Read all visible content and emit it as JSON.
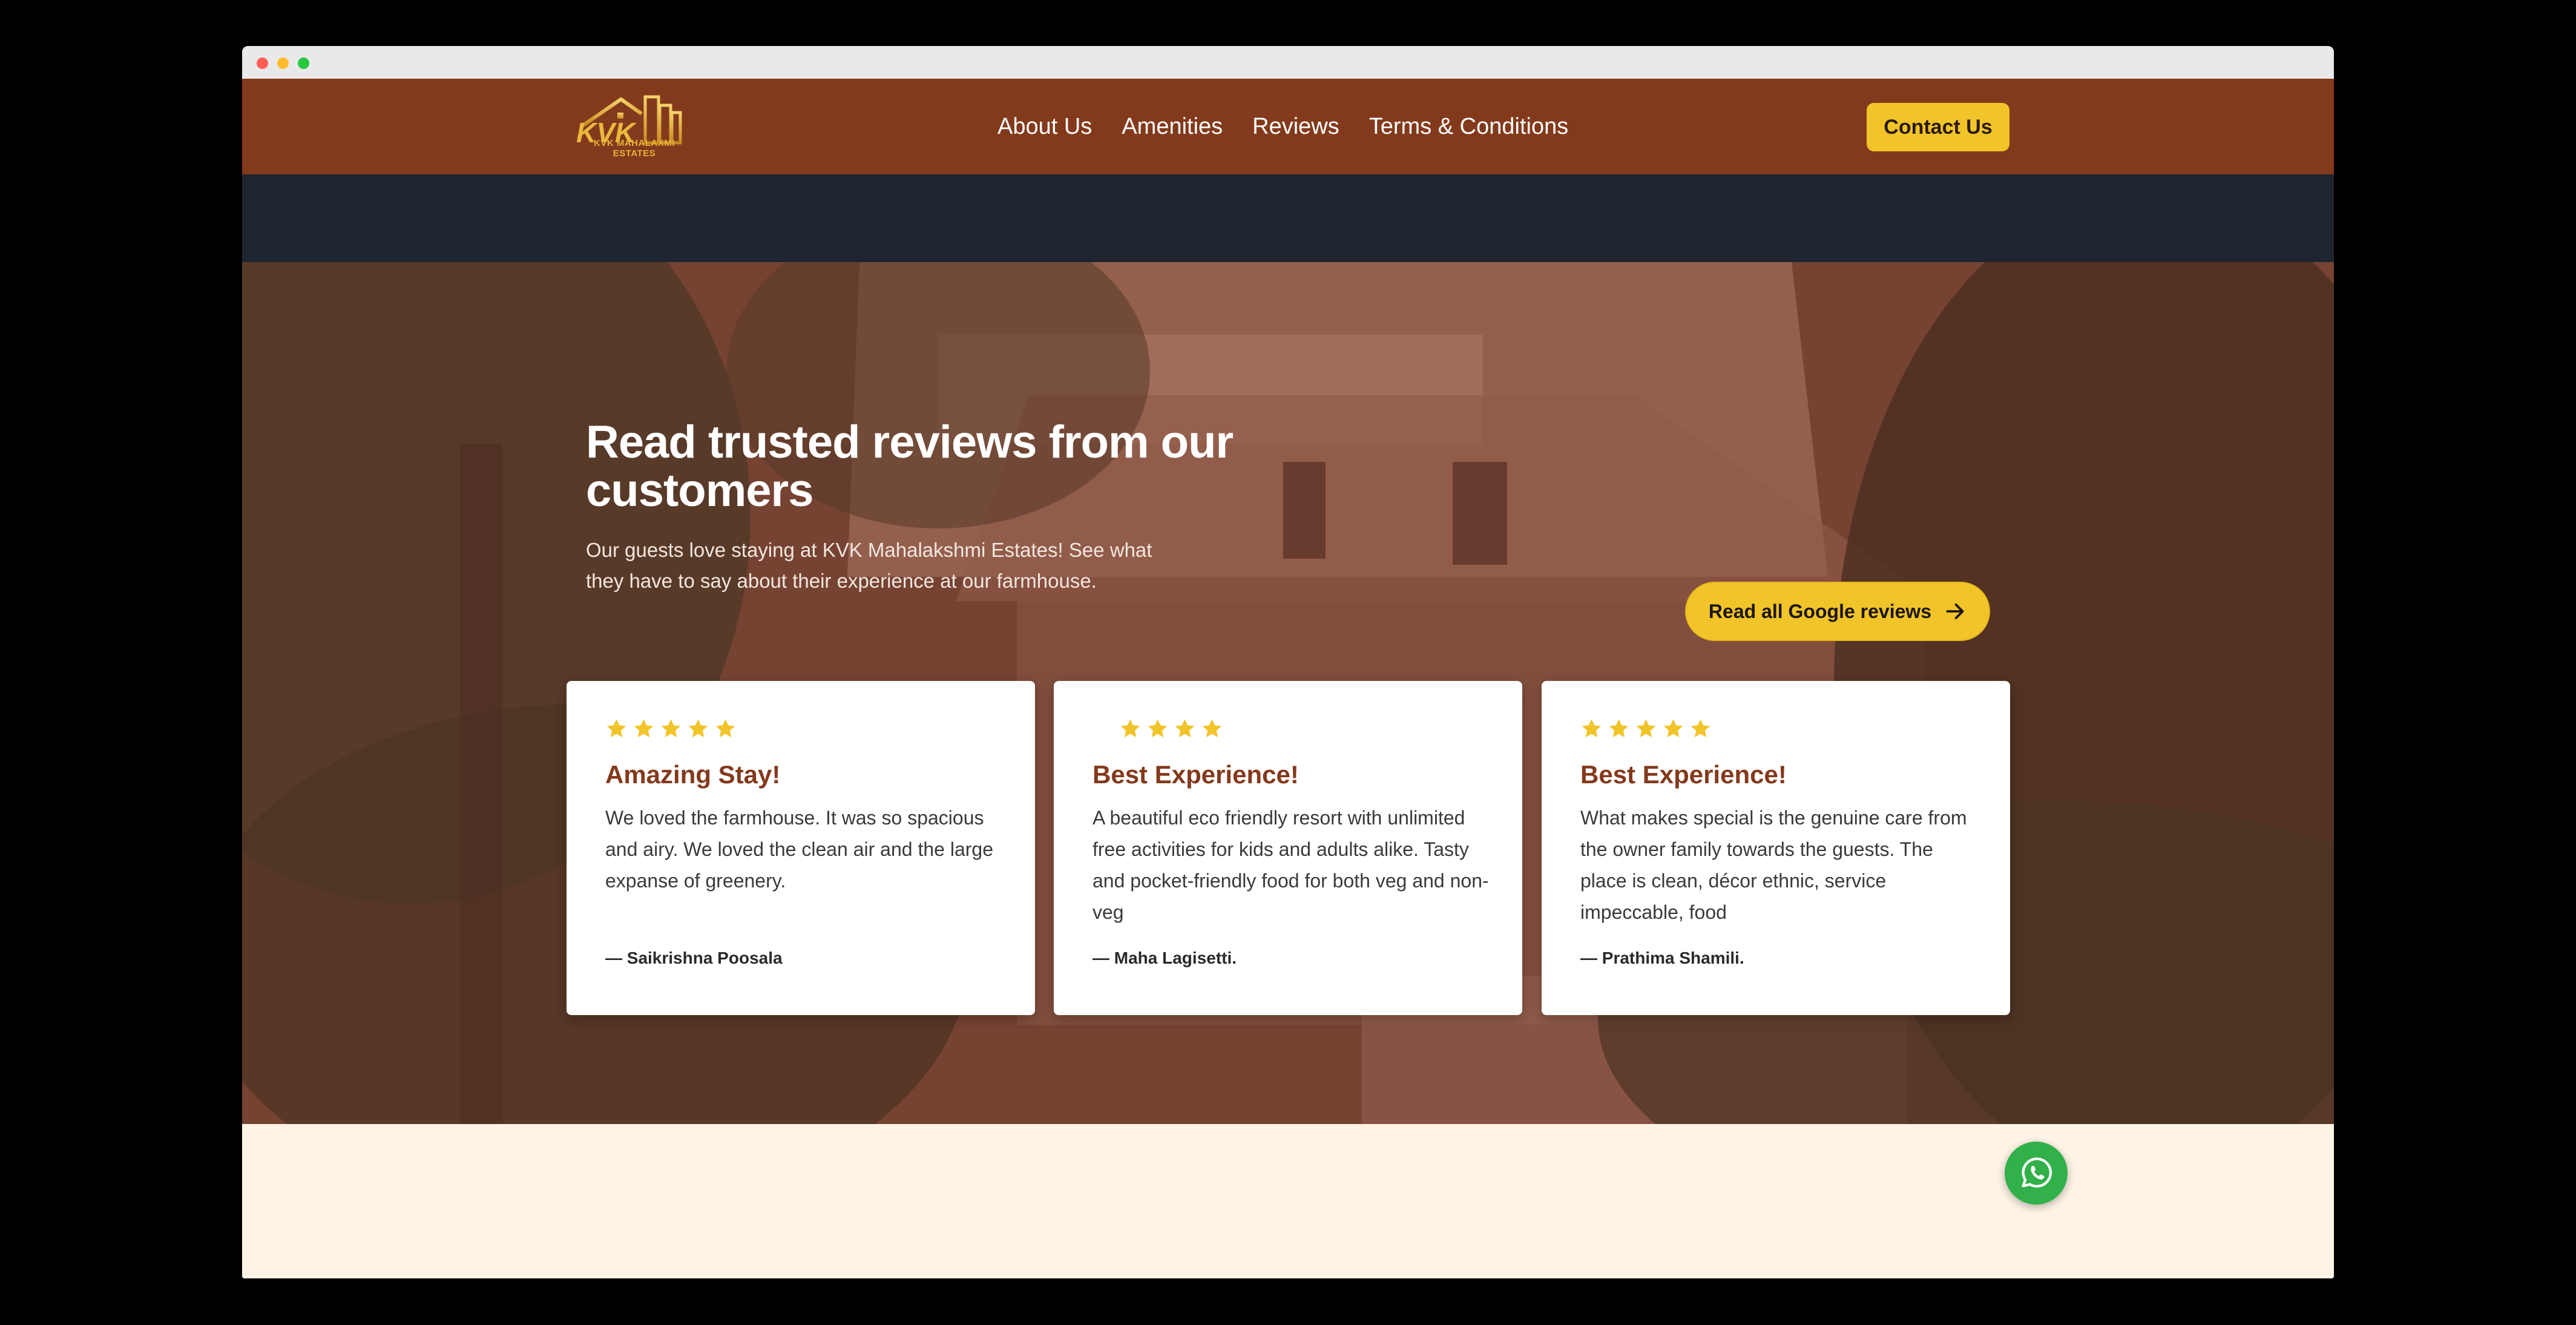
{
  "brand": {
    "logo_initials": "KVK",
    "logo_text": "KVK MAHALAXMI ESTATES",
    "accent_color": "#833a1c",
    "button_color": "#f1c42a"
  },
  "nav": {
    "links": [
      "About Us",
      "Amenities",
      "Reviews",
      "Terms & Conditions"
    ],
    "contact_label": "Contact Us"
  },
  "hero": {
    "title": "Read trusted reviews from our customers",
    "subtitle": "Our guests love staying at KVK Mahalakshmi Estates! See what they have to say about their experience at our farmhouse.",
    "google_button_label": "Read all Google reviews"
  },
  "reviews": [
    {
      "stars": 5,
      "title": "Amazing Stay!",
      "body": "We loved the farmhouse. It was so spacious and airy. We loved the clean air and the large expanse of greenery.",
      "author": "— Saikrishna Poosala"
    },
    {
      "stars": 4,
      "title": "Best Experience!",
      "body": "A beautiful eco friendly resort with unlimited free activities for kids and adults alike. Tasty and pocket-friendly food for both veg and non-veg",
      "author": "— Maha Lagisetti."
    },
    {
      "stars": 5,
      "title": "Best Experience!",
      "body": "What makes special is the genuine care from the owner family towards the guests. The place is clean, décor ethnic, service impeccable, food",
      "author": "— Prathima Shamili."
    }
  ],
  "floating": {
    "whatsapp_icon": "whatsapp-icon"
  }
}
